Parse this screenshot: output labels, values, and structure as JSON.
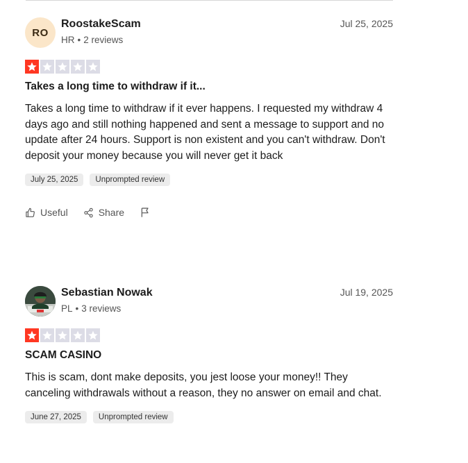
{
  "reviews": [
    {
      "avatar_initials": "RO",
      "name": "RoostakeScam",
      "country": "HR",
      "review_count": "2 reviews",
      "date": "Jul 25, 2025",
      "rating": 1,
      "title": "Takes a long time to withdraw if it...",
      "body": "Takes a long time to withdraw if it ever happens. I requested my withdraw 4 days ago and still nothing happened and sent a message to support and no update after 24 hours. Support is non existent and you can't withdraw. Don't deposit your money because you will never get it back",
      "experience_date": "July 25, 2025",
      "tag": "Unprompted review",
      "actions": {
        "useful": "Useful",
        "share": "Share"
      }
    },
    {
      "avatar_initials": "",
      "name": "Sebastian Nowak",
      "country": "PL",
      "review_count": "3 reviews",
      "date": "Jul 19, 2025",
      "rating": 1,
      "title": "SCAM CASINO",
      "body": "This is scam, dont make deposits, you jest loose your money!! They canceling withdrawals without a reason, they no answer on email and chat.",
      "experience_date": "June 27, 2025",
      "tag": "Unprompted review"
    }
  ],
  "colors": {
    "star_active": "#ff3722",
    "star_inactive": "#dcdce6",
    "tag_bg": "#ececec"
  }
}
